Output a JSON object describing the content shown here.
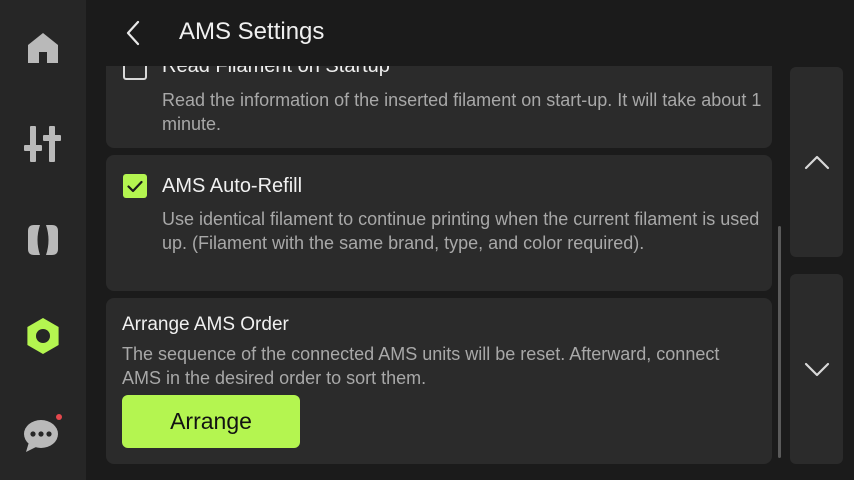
{
  "header": {
    "title": "AMS Settings"
  },
  "options": [
    {
      "title": "Read Filament on Startup",
      "description": "Read the information of the inserted filament on start-up. It will take about 1 minute.",
      "checked": false
    },
    {
      "title": "AMS Auto-Refill",
      "description": "Use identical filament to continue printing when the current filament is used up. (Filament with the same brand, type, and color required).",
      "checked": true
    }
  ],
  "arrange": {
    "title": "Arrange AMS Order",
    "description": "The sequence of the connected AMS units will be reset. Afterward, connect AMS in the desired order to sort them.",
    "button_label": "Arrange"
  },
  "colors": {
    "accent": "#b4f550",
    "background": "#1b1b1b",
    "panel": "#2b2b2b",
    "sidebar": "#262626",
    "notification": "#e5484d"
  },
  "icons": {
    "nav": [
      "home-icon",
      "controls-icon",
      "filament-icon",
      "settings-icon",
      "messages-icon"
    ],
    "back": "chevron-left-icon",
    "scroll_up": "chevron-up-icon",
    "scroll_down": "chevron-down-icon",
    "check": "checkmark-icon"
  }
}
